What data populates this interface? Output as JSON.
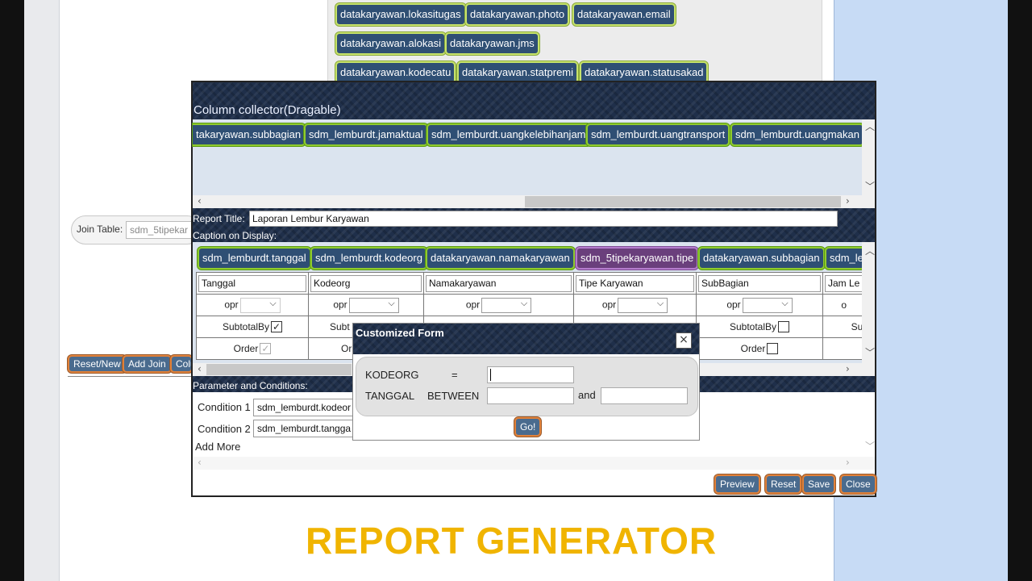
{
  "top_fields": [
    "datakaryawan.lokasitugas",
    "datakaryawan.photo",
    "datakaryawan.email",
    "datakaryawan.alokasi",
    "datakaryawan.jms",
    "datakaryawan.kodecatu",
    "datakaryawan.statpremi",
    "datakaryawan.statusakad"
  ],
  "join": {
    "label": "Join Table:",
    "value": "sdm_5tipekar"
  },
  "left_buttons": [
    "Reset/New",
    "Add Join",
    "Colu"
  ],
  "collector": {
    "title": "Column collector(Dragable)",
    "chips": [
      "takaryawan.subbagian",
      "sdm_lemburdt.jamaktual",
      "sdm_lemburdt.uangkelebihanjam",
      "sdm_lemburdt.uangtransport",
      "sdm_lemburdt.uangmakan"
    ]
  },
  "report": {
    "title_label": "Report Title:",
    "title_value": "Laporan Lembur Karyawan",
    "caption_label": "Caption on Display:"
  },
  "display_chips": [
    "sdm_lemburdt.tanggal",
    "sdm_lemburdt.kodeorg",
    "datakaryawan.namakaryawan",
    "sdm_5tipekaryawan.tipe",
    "datakaryawan.subbagian",
    "sdm_le"
  ],
  "columns": [
    {
      "caption": "Tanggal",
      "opr": "opr",
      "subtotal_label": "SubtotalBy",
      "subtotal": "checked",
      "order_label": "Order",
      "order": "checked"
    },
    {
      "caption": "Kodeorg",
      "opr": "opr",
      "subtotal_label": "Subt",
      "order_label": "Or"
    },
    {
      "caption": "Namakaryawan",
      "opr": "opr"
    },
    {
      "caption": "Tipe Karyawan",
      "opr": "opr"
    },
    {
      "caption": "SubBagian",
      "opr": "opr",
      "subtotal_label": "SubtotalBy",
      "order_label": "Order"
    },
    {
      "caption": "Jam Le",
      "opr": "o",
      "subtotal_label": "Su"
    }
  ],
  "params": {
    "header": "Parameter and Conditions:",
    "conditions": [
      {
        "label": "Condition 1",
        "value": "sdm_lemburdt.kodeor"
      },
      {
        "label": "Condition 2",
        "value": "sdm_lemburdt.tangga"
      }
    ],
    "add_more": "Add More"
  },
  "footer_buttons": {
    "preview": "Preview",
    "reset": "Reset",
    "save": "Save",
    "close": "Close"
  },
  "custom_form": {
    "title": "Customized Form",
    "close": "×",
    "row1": {
      "field": "KODEORG",
      "op": "="
    },
    "row2": {
      "field": "TANGGAL",
      "op": "BETWEEN",
      "and": "and"
    },
    "go": "Go!"
  },
  "banner": "REPORT GENERATOR"
}
